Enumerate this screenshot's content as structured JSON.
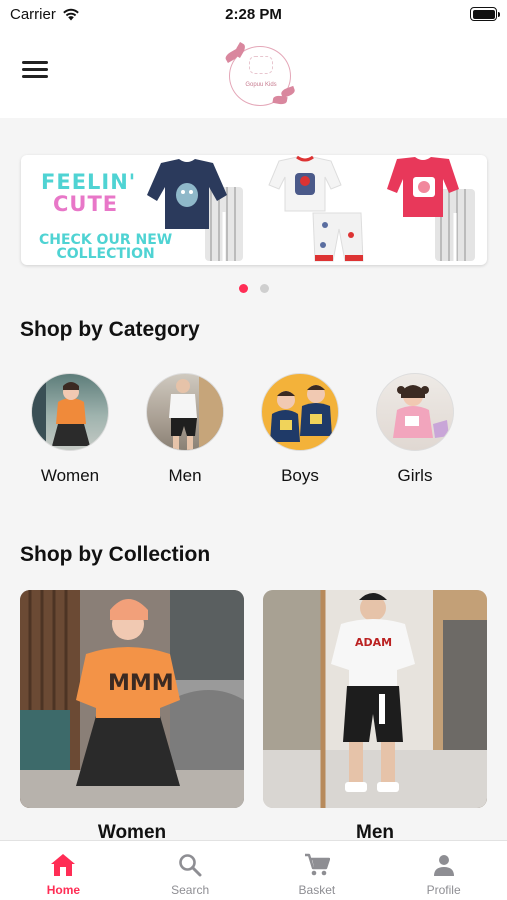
{
  "status_bar": {
    "carrier": "Carrier",
    "time": "2:28 PM"
  },
  "header": {
    "logo_text": "Gopuu Kids"
  },
  "banner": {
    "line1": "FEELIN'",
    "line2": "CUTE",
    "line3": "CHECK OUR NEW",
    "line4": "COLLECTION"
  },
  "carousel": {
    "pages": 2,
    "active": 0
  },
  "categories": {
    "title": "Shop by Category",
    "items": [
      {
        "label": "Women"
      },
      {
        "label": "Men"
      },
      {
        "label": "Boys"
      },
      {
        "label": "Girls"
      }
    ]
  },
  "collections": {
    "title": "Shop by Collection",
    "items": [
      {
        "label": "Women"
      },
      {
        "label": "Men"
      }
    ]
  },
  "tab_bar": {
    "active": "Home",
    "items": [
      {
        "label": "Home",
        "icon": "home-icon"
      },
      {
        "label": "Search",
        "icon": "search-icon"
      },
      {
        "label": "Basket",
        "icon": "cart-icon"
      },
      {
        "label": "Profile",
        "icon": "person-icon"
      }
    ]
  },
  "colors": {
    "accent": "#ff2d55",
    "inactive": "#8e8e93",
    "logo_pink": "#d9879e"
  }
}
